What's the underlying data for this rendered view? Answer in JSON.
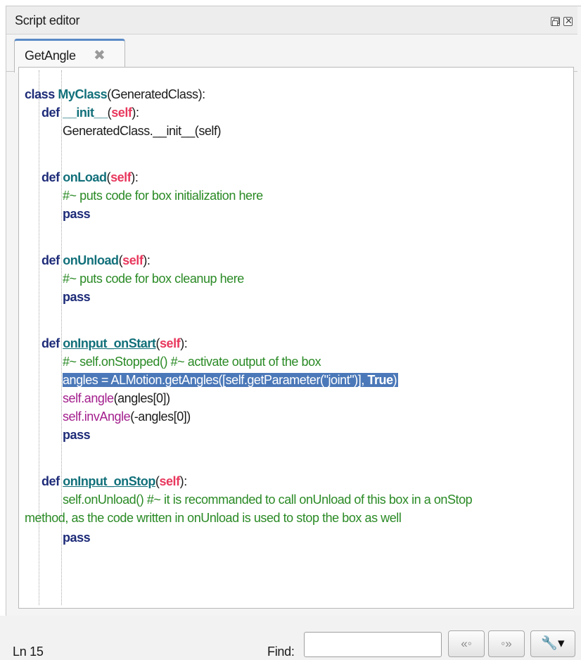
{
  "window": {
    "title": "Script editor"
  },
  "tabs": [
    {
      "label": "GetAngle"
    }
  ],
  "status": {
    "line": "Ln 15",
    "find_label": "Find:",
    "find_value": ""
  },
  "icons": {
    "float": "float-window-icon",
    "close": "close-window-icon",
    "tab_close": "tab-close-icon",
    "prev": "find-previous-icon",
    "next": "find-next-icon",
    "tool": "wrench-icon"
  },
  "code": {
    "l1": [
      "class",
      " ",
      "MyClass",
      "(GeneratedClass):"
    ],
    "l2": [
      "def",
      " ",
      "__init__",
      "(",
      "self",
      "):"
    ],
    "l3": [
      "GeneratedClass.__init__(self)"
    ],
    "l5": [
      "def",
      " ",
      "onLoad",
      "(",
      "self",
      "):"
    ],
    "l6": [
      "#~ puts code for box initialization here"
    ],
    "l7": [
      "pass"
    ],
    "l9": [
      "def",
      " ",
      "onUnload",
      "(",
      "self",
      "):"
    ],
    "l10": [
      "#~ puts code for box cleanup here"
    ],
    "l11": [
      "pass"
    ],
    "l13": [
      "def",
      " ",
      "onInput_onStart",
      "(",
      "self",
      "):"
    ],
    "l14": [
      "#~ self.onStopped() #~ activate output of the box"
    ],
    "l15": [
      "angles = ALMotion.getAngles([self.getParameter(\"joint\")], ",
      "True",
      ")"
    ],
    "l16": [
      "self.angle",
      "(angles[0])"
    ],
    "l17": [
      "self.invAngle",
      "(-angles[0])"
    ],
    "l18": [
      "pass"
    ],
    "l20": [
      "def",
      " ",
      "onInput_onStop",
      "(",
      "self",
      "):"
    ],
    "l21": [
      "self.onUnload() #~ it is recommanded to call onUnload of this box in a onStop"
    ],
    "l22": [
      "method, as the code written in onUnload is used to stop the box as well"
    ],
    "l23": [
      "pass"
    ]
  }
}
